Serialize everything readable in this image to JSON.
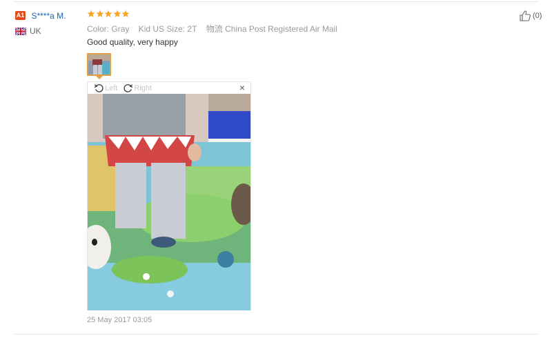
{
  "review": {
    "badge": "A1",
    "username": "S****a M.",
    "country": "UK",
    "rating": 5,
    "color_label": "Color:",
    "color_value": "Gray",
    "size_label": "Kid US Size:",
    "size_value": "2T",
    "shipping_label": "物流",
    "shipping_value": "China Post Registered Air Mail",
    "text": "Good quality, very happy",
    "date": "25 May 2017 03:05",
    "helpful_count": "(0)"
  },
  "viewer": {
    "rotate_left": "Left",
    "rotate_right": "Right",
    "close": "×"
  },
  "colors": {
    "star": "#f5a623",
    "username": "#1a5fb4",
    "badge": "#e64a19",
    "thumb_border": "#e0a040"
  },
  "icons": [
    "user-level-badge",
    "uk-flag-icon",
    "star-icon",
    "rotate-left-icon",
    "rotate-right-icon",
    "close-icon",
    "thumbs-up-icon"
  ]
}
